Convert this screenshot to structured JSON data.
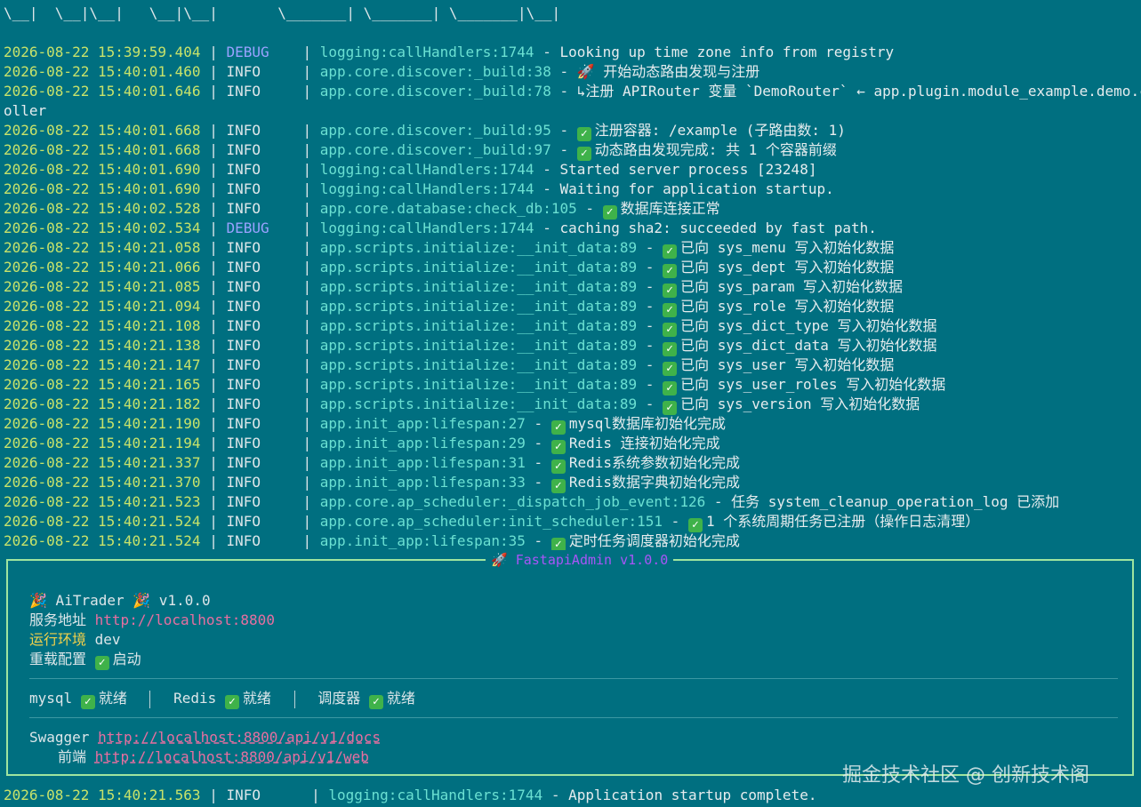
{
  "ascii_art": "\\__|  \\__|\\__|   \\__|\\__|       \\_______| \\_______| \\_______|\\__|",
  "logs": [
    {
      "ts": "2026-08-22 15:39:59.404",
      "level": "DEBUG",
      "src": "logging:callHandlers:1744",
      "msg": "Looking up time zone info from registry"
    },
    {
      "ts": "2026-08-22 15:40:01.460",
      "level": "INFO",
      "src": "app.core.discover:_build:38",
      "msg": "🚀 开始动态路由发现与注册"
    },
    {
      "ts": "2026-08-22 15:40:01.646",
      "level": "INFO",
      "src": "app.core.discover:_build:78",
      "msg": "  ↳注册 APIRouter 变量 `DemoRouter` ← app.plugin.module_example.demo.contr",
      "cont": "oller"
    },
    {
      "ts": "2026-08-22 15:40:01.668",
      "level": "INFO",
      "src": "app.core.discover:_build:95",
      "check": true,
      "msg": "注册容器: /example (子路由数: 1)"
    },
    {
      "ts": "2026-08-22 15:40:01.668",
      "level": "INFO",
      "src": "app.core.discover:_build:97",
      "check": true,
      "msg": "动态路由发现完成: 共 1 个容器前缀"
    },
    {
      "ts": "2026-08-22 15:40:01.690",
      "level": "INFO",
      "src": "logging:callHandlers:1744",
      "msg": "Started server process [23248]"
    },
    {
      "ts": "2026-08-22 15:40:01.690",
      "level": "INFO",
      "src": "logging:callHandlers:1744",
      "msg": "Waiting for application startup."
    },
    {
      "ts": "2026-08-22 15:40:02.528",
      "level": "INFO",
      "src": "app.core.database:check_db:105",
      "check": true,
      "msg": "数据库连接正常"
    },
    {
      "ts": "2026-08-22 15:40:02.534",
      "level": "DEBUG",
      "src": "logging:callHandlers:1744",
      "msg": "caching sha2: succeeded by fast path."
    },
    {
      "ts": "2026-08-22 15:40:21.058",
      "level": "INFO",
      "src": "app.scripts.initialize:__init_data:89",
      "check": true,
      "msg": "已向 sys_menu 写入初始化数据"
    },
    {
      "ts": "2026-08-22 15:40:21.066",
      "level": "INFO",
      "src": "app.scripts.initialize:__init_data:89",
      "check": true,
      "msg": "已向 sys_dept 写入初始化数据"
    },
    {
      "ts": "2026-08-22 15:40:21.085",
      "level": "INFO",
      "src": "app.scripts.initialize:__init_data:89",
      "check": true,
      "msg": "已向 sys_param 写入初始化数据"
    },
    {
      "ts": "2026-08-22 15:40:21.094",
      "level": "INFO",
      "src": "app.scripts.initialize:__init_data:89",
      "check": true,
      "msg": "已向 sys_role 写入初始化数据"
    },
    {
      "ts": "2026-08-22 15:40:21.108",
      "level": "INFO",
      "src": "app.scripts.initialize:__init_data:89",
      "check": true,
      "msg": "已向 sys_dict_type 写入初始化数据"
    },
    {
      "ts": "2026-08-22 15:40:21.138",
      "level": "INFO",
      "src": "app.scripts.initialize:__init_data:89",
      "check": true,
      "msg": "已向 sys_dict_data 写入初始化数据"
    },
    {
      "ts": "2026-08-22 15:40:21.147",
      "level": "INFO",
      "src": "app.scripts.initialize:__init_data:89",
      "check": true,
      "msg": "已向 sys_user 写入初始化数据"
    },
    {
      "ts": "2026-08-22 15:40:21.165",
      "level": "INFO",
      "src": "app.scripts.initialize:__init_data:89",
      "check": true,
      "msg": "已向 sys_user_roles 写入初始化数据"
    },
    {
      "ts": "2026-08-22 15:40:21.182",
      "level": "INFO",
      "src": "app.scripts.initialize:__init_data:89",
      "check": true,
      "msg": "已向 sys_version 写入初始化数据"
    },
    {
      "ts": "2026-08-22 15:40:21.190",
      "level": "INFO",
      "src": "app.init_app:lifespan:27",
      "check": true,
      "msg": "mysql数据库初始化完成"
    },
    {
      "ts": "2026-08-22 15:40:21.194",
      "level": "INFO",
      "src": "app.init_app:lifespan:29",
      "check": true,
      "msg": "Redis 连接初始化完成"
    },
    {
      "ts": "2026-08-22 15:40:21.337",
      "level": "INFO",
      "src": "app.init_app:lifespan:31",
      "check": true,
      "msg": "Redis系统参数初始化完成"
    },
    {
      "ts": "2026-08-22 15:40:21.370",
      "level": "INFO",
      "src": "app.init_app:lifespan:33",
      "check": true,
      "msg": "Redis数据字典初始化完成"
    },
    {
      "ts": "2026-08-22 15:40:21.523",
      "level": "INFO",
      "src": "app.core.ap_scheduler:_dispatch_job_event:126",
      "msg": "任务 system_cleanup_operation_log 已添加"
    },
    {
      "ts": "2026-08-22 15:40:21.524",
      "level": "INFO",
      "src": "app.core.ap_scheduler:init_scheduler:151",
      "check": true,
      "msg": "1 个系统周期任务已注册（操作日志清理）"
    },
    {
      "ts": "2026-08-22 15:40:21.524",
      "level": "INFO",
      "src": "app.init_app:lifespan:35",
      "check": true,
      "msg": "定时任务调度器初始化完成"
    }
  ],
  "panel": {
    "title": "🚀 FastapiAdmin v1.0.0",
    "app_name": "🎉 AiTrader 🎉  v1.0.0",
    "service_label": "服务地址",
    "service_url": "http://localhost:8800",
    "env_label": "运行环境",
    "env_value": "dev",
    "reload_label": "重载配置",
    "reload_value": "启动",
    "status": [
      {
        "name": "mysql",
        "value": "就绪"
      },
      {
        "name": "Redis",
        "value": "就绪"
      },
      {
        "name": "调度器",
        "value": "就绪"
      }
    ],
    "swagger_label": "Swagger",
    "swagger_url": "http://localhost:8800/api/v1/docs",
    "frontend_label": "前端",
    "frontend_url": "http://localhost:8800/api/v1/web"
  },
  "final_log": {
    "ts": "2026-08-22 15:40:21.563",
    "level": "INFO",
    "src": "logging:callHandlers:1744",
    "msg": "Application startup complete."
  },
  "watermark": "掘金技术社区 @ 创新技术阁",
  "colors": {
    "background": "#006f80",
    "timestamp": "#c8e36a",
    "source": "#6be0d2",
    "debug": "#9aa2ff",
    "panel_border": "#9fe59f",
    "url": "#e86fa0",
    "panel_title": "#a855f7",
    "env_label": "#f2d14a"
  }
}
